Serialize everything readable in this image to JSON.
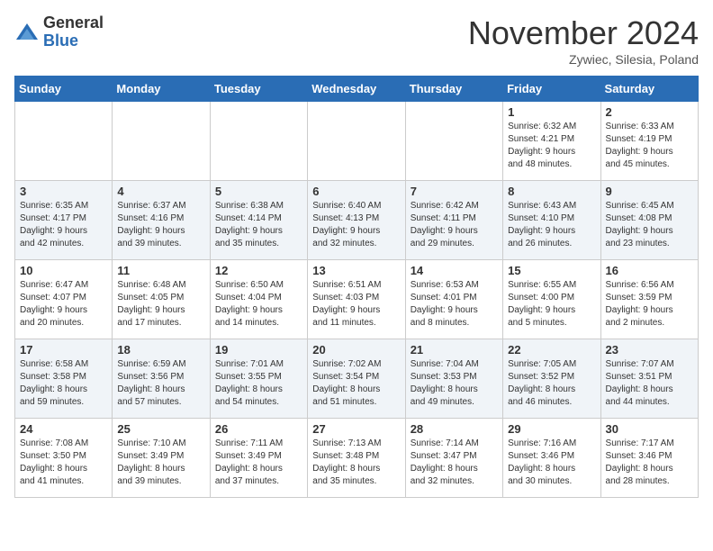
{
  "header": {
    "logo_general": "General",
    "logo_blue": "Blue",
    "month_title": "November 2024",
    "subtitle": "Zywiec, Silesia, Poland"
  },
  "weekdays": [
    "Sunday",
    "Monday",
    "Tuesday",
    "Wednesday",
    "Thursday",
    "Friday",
    "Saturday"
  ],
  "weeks": [
    [
      {
        "day": "",
        "info": ""
      },
      {
        "day": "",
        "info": ""
      },
      {
        "day": "",
        "info": ""
      },
      {
        "day": "",
        "info": ""
      },
      {
        "day": "",
        "info": ""
      },
      {
        "day": "1",
        "info": "Sunrise: 6:32 AM\nSunset: 4:21 PM\nDaylight: 9 hours\nand 48 minutes."
      },
      {
        "day": "2",
        "info": "Sunrise: 6:33 AM\nSunset: 4:19 PM\nDaylight: 9 hours\nand 45 minutes."
      }
    ],
    [
      {
        "day": "3",
        "info": "Sunrise: 6:35 AM\nSunset: 4:17 PM\nDaylight: 9 hours\nand 42 minutes."
      },
      {
        "day": "4",
        "info": "Sunrise: 6:37 AM\nSunset: 4:16 PM\nDaylight: 9 hours\nand 39 minutes."
      },
      {
        "day": "5",
        "info": "Sunrise: 6:38 AM\nSunset: 4:14 PM\nDaylight: 9 hours\nand 35 minutes."
      },
      {
        "day": "6",
        "info": "Sunrise: 6:40 AM\nSunset: 4:13 PM\nDaylight: 9 hours\nand 32 minutes."
      },
      {
        "day": "7",
        "info": "Sunrise: 6:42 AM\nSunset: 4:11 PM\nDaylight: 9 hours\nand 29 minutes."
      },
      {
        "day": "8",
        "info": "Sunrise: 6:43 AM\nSunset: 4:10 PM\nDaylight: 9 hours\nand 26 minutes."
      },
      {
        "day": "9",
        "info": "Sunrise: 6:45 AM\nSunset: 4:08 PM\nDaylight: 9 hours\nand 23 minutes."
      }
    ],
    [
      {
        "day": "10",
        "info": "Sunrise: 6:47 AM\nSunset: 4:07 PM\nDaylight: 9 hours\nand 20 minutes."
      },
      {
        "day": "11",
        "info": "Sunrise: 6:48 AM\nSunset: 4:05 PM\nDaylight: 9 hours\nand 17 minutes."
      },
      {
        "day": "12",
        "info": "Sunrise: 6:50 AM\nSunset: 4:04 PM\nDaylight: 9 hours\nand 14 minutes."
      },
      {
        "day": "13",
        "info": "Sunrise: 6:51 AM\nSunset: 4:03 PM\nDaylight: 9 hours\nand 11 minutes."
      },
      {
        "day": "14",
        "info": "Sunrise: 6:53 AM\nSunset: 4:01 PM\nDaylight: 9 hours\nand 8 minutes."
      },
      {
        "day": "15",
        "info": "Sunrise: 6:55 AM\nSunset: 4:00 PM\nDaylight: 9 hours\nand 5 minutes."
      },
      {
        "day": "16",
        "info": "Sunrise: 6:56 AM\nSunset: 3:59 PM\nDaylight: 9 hours\nand 2 minutes."
      }
    ],
    [
      {
        "day": "17",
        "info": "Sunrise: 6:58 AM\nSunset: 3:58 PM\nDaylight: 8 hours\nand 59 minutes."
      },
      {
        "day": "18",
        "info": "Sunrise: 6:59 AM\nSunset: 3:56 PM\nDaylight: 8 hours\nand 57 minutes."
      },
      {
        "day": "19",
        "info": "Sunrise: 7:01 AM\nSunset: 3:55 PM\nDaylight: 8 hours\nand 54 minutes."
      },
      {
        "day": "20",
        "info": "Sunrise: 7:02 AM\nSunset: 3:54 PM\nDaylight: 8 hours\nand 51 minutes."
      },
      {
        "day": "21",
        "info": "Sunrise: 7:04 AM\nSunset: 3:53 PM\nDaylight: 8 hours\nand 49 minutes."
      },
      {
        "day": "22",
        "info": "Sunrise: 7:05 AM\nSunset: 3:52 PM\nDaylight: 8 hours\nand 46 minutes."
      },
      {
        "day": "23",
        "info": "Sunrise: 7:07 AM\nSunset: 3:51 PM\nDaylight: 8 hours\nand 44 minutes."
      }
    ],
    [
      {
        "day": "24",
        "info": "Sunrise: 7:08 AM\nSunset: 3:50 PM\nDaylight: 8 hours\nand 41 minutes."
      },
      {
        "day": "25",
        "info": "Sunrise: 7:10 AM\nSunset: 3:49 PM\nDaylight: 8 hours\nand 39 minutes."
      },
      {
        "day": "26",
        "info": "Sunrise: 7:11 AM\nSunset: 3:49 PM\nDaylight: 8 hours\nand 37 minutes."
      },
      {
        "day": "27",
        "info": "Sunrise: 7:13 AM\nSunset: 3:48 PM\nDaylight: 8 hours\nand 35 minutes."
      },
      {
        "day": "28",
        "info": "Sunrise: 7:14 AM\nSunset: 3:47 PM\nDaylight: 8 hours\nand 32 minutes."
      },
      {
        "day": "29",
        "info": "Sunrise: 7:16 AM\nSunset: 3:46 PM\nDaylight: 8 hours\nand 30 minutes."
      },
      {
        "day": "30",
        "info": "Sunrise: 7:17 AM\nSunset: 3:46 PM\nDaylight: 8 hours\nand 28 minutes."
      }
    ]
  ]
}
